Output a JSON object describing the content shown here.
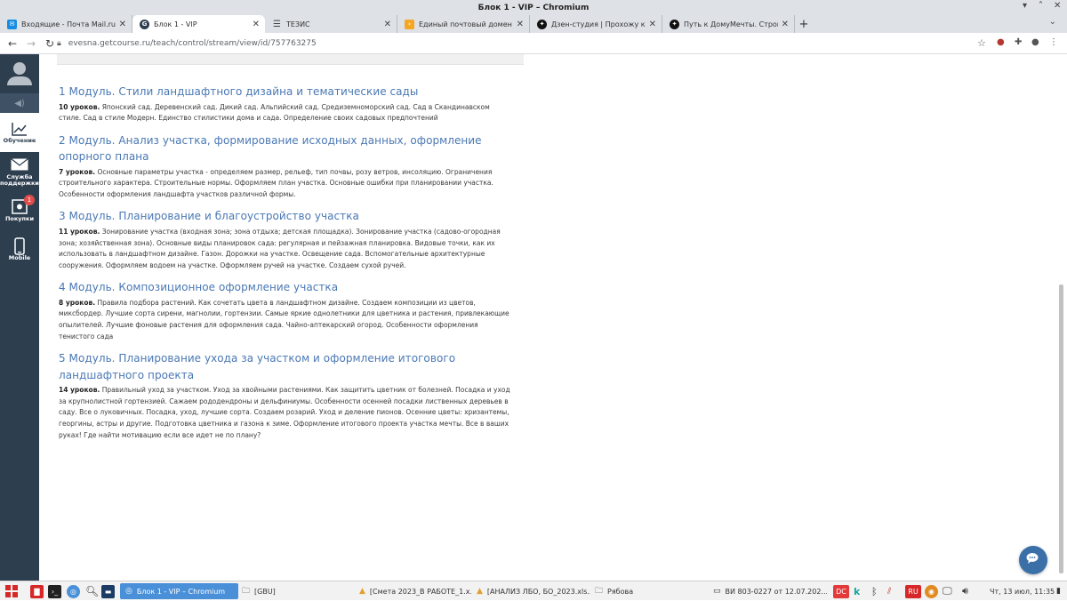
{
  "window": {
    "title": "Блок 1 - VIP – Chromium"
  },
  "tabs": [
    {
      "label": "Входящие - Почта Mail.ru",
      "icon": "mail-icon",
      "color": "#168de2",
      "active": false
    },
    {
      "label": "Блок 1 - VIP",
      "icon": "getcourse-icon",
      "color": "#2d3e4f",
      "active": true
    },
    {
      "label": "ТЕЗИС",
      "icon": "menu-icon",
      "color": "#555555",
      "active": false
    },
    {
      "label": "Единый почтовый домен Ян",
      "icon": "yandex-icon",
      "color": "#f5a623",
      "active": false
    },
    {
      "label": "Дзен-студия | Прохожу курс",
      "icon": "dzen-icon",
      "color": "#111111",
      "active": false
    },
    {
      "label": "Путь к ДомуМечты. Строй",
      "icon": "dzen-icon",
      "color": "#111111",
      "active": false
    }
  ],
  "address": {
    "url": "evesna.getcourse.ru/teach/control/stream/view/id/757763275"
  },
  "sidebar": {
    "items": [
      {
        "label": "Обучение",
        "icon": "chart-icon",
        "active": true,
        "badge": ""
      },
      {
        "label": "Служба поддержки",
        "icon": "envelope-icon",
        "active": false,
        "badge": ""
      },
      {
        "label": "Покупки",
        "icon": "cart-icon",
        "active": false,
        "badge": "1"
      },
      {
        "label": "Mobile",
        "icon": "mobile-icon",
        "active": false,
        "badge": ""
      }
    ]
  },
  "modules": [
    {
      "title": "1 Модуль. Стили ландшафтного дизайна и тематические сады",
      "count": "10 уроков.",
      "desc": "Японский сад. Деревенский сад. Дикий сад. Альпийский сад. Средиземноморский сад. Сад в Скандинавском стиле. Сад в стиле Модерн. Единство стилистики дома и сада. Определение своих садовых предпочтений"
    },
    {
      "title": "2 Модуль. Анализ участка, формирование исходных данных, оформление опорного плана",
      "count": "7 уроков.",
      "desc": "Основные параметры участка - определяем размер, рельеф, тип почвы, розу ветров, инсоляцию. Ограничения строительного характера. Строительные нормы. Оформляем план участка. Основные ошибки при планировании участка. Особенности оформления ландшафта участков различной формы."
    },
    {
      "title": "3 Модуль. Планирование и благоустройство участка",
      "count": "11 уроков.",
      "desc": "Зонирование участка (входная зона; зона отдыха; детская площадка). Зонирование участка (садово-огородная зона; хозяйственная зона). Основные виды планировок сада: регулярная и пейзажная планировка. Видовые точки, как их использовать в ландшафтном дизайне. Газон. Дорожки на участке. Освещение сада. Вспомогательные архитектурные сооружения. Оформляем водоем на участке. Оформляем ручей на участке. Создаем сухой ручей."
    },
    {
      "title": "4 Модуль. Композиционное оформление участка",
      "count": "8 уроков.",
      "desc": "Правила подбора растений. Как сочетать цвета в ландшафтном дизайне. Создаем композиции из цветов, миксбордер. Лучшие сорта сирени, магнолии, гортензии. Самые яркие однолетники для цветника и растения, привлекающие опылителей. Лучшие фоновые растения для оформления сада. Чайно-аптекарский огород. Особенности оформления тенистого сада"
    },
    {
      "title": "5 Модуль. Планирование ухода за участком и оформление итогового ландшафтного проекта",
      "count": "14 уроков.",
      "desc": "Правильный уход за участком. Уход за хвойными растениями. Как защитить цветник от болезней. Посадка и уход за крупнолистной гортензией. Сажаем рододендроны и дельфиниумы. Особенности осенней посадки лиственных деревьев в саду. Все о луковичных. Посадка, уход, лучшие сорта. Создаем розарий. Уход и деление пионов. Осенние цветы: хризантемы, георгины, астры и другие. Подготовка цветника и газона к зиме. Оформление итогового проекта участка мечты. Все в ваших руках! Где найти мотивацию если все идет не по плану?"
    }
  ],
  "taskbar": {
    "active_window": "Блок 1 - VIP – Chromium",
    "items": [
      {
        "label": "[GBU]"
      },
      {
        "label": "[Смета 2023_В РАБОТЕ_1.x..."
      },
      {
        "label": "[АНАЛИЗ ЛБО, БО_2023.xls..."
      },
      {
        "label": "Рябова"
      },
      {
        "label": "ВИ 803-0227 от 12.07.202..."
      }
    ],
    "clock": "Чт, 13 июл, 11:35",
    "lang": "RU"
  }
}
